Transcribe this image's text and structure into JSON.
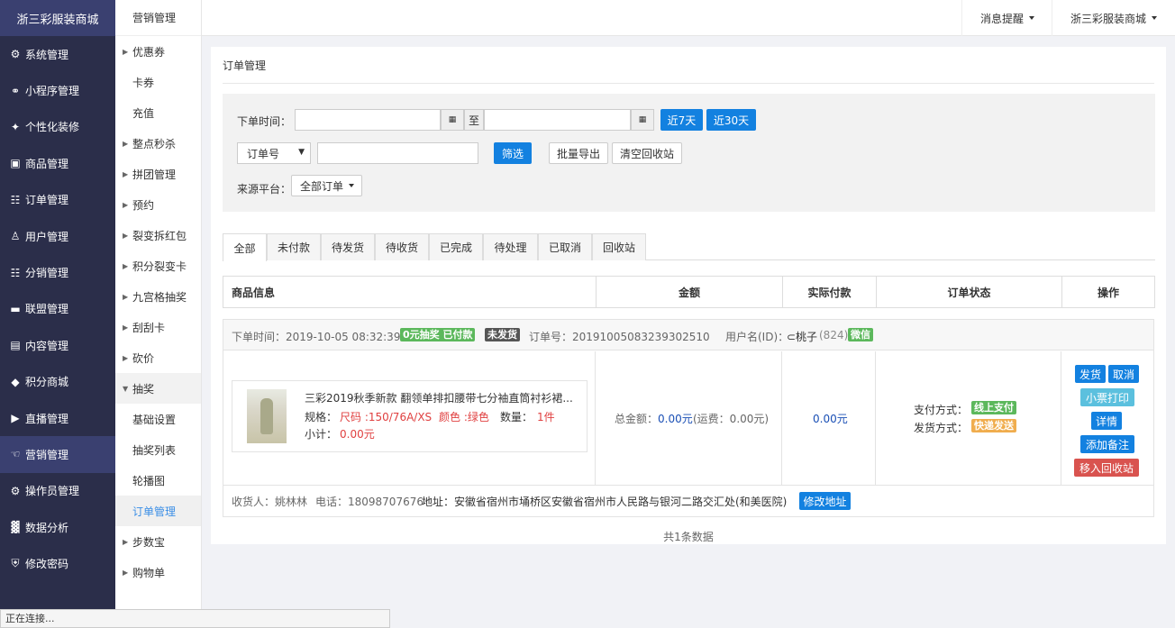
{
  "brand": "浙三彩服装商城",
  "sidebar": {
    "items": [
      {
        "label": "系统管理",
        "icon": "gear-icon"
      },
      {
        "label": "小程序管理",
        "icon": "link-icon"
      },
      {
        "label": "个性化装修",
        "icon": "diamond-icon"
      },
      {
        "label": "商品管理",
        "icon": "bag-icon"
      },
      {
        "label": "订单管理",
        "icon": "clipboard-icon"
      },
      {
        "label": "用户管理",
        "icon": "user-icon"
      },
      {
        "label": "分销管理",
        "icon": "sitemap-icon"
      },
      {
        "label": "联盟管理",
        "icon": "card-icon"
      },
      {
        "label": "内容管理",
        "icon": "newspaper-icon"
      },
      {
        "label": "积分商城",
        "icon": "cube-icon"
      },
      {
        "label": "直播管理",
        "icon": "play-icon"
      },
      {
        "label": "营销管理",
        "icon": "hand-icon"
      },
      {
        "label": "操作员管理",
        "icon": "cog-icon"
      },
      {
        "label": "数据分析",
        "icon": "bar-chart-icon"
      },
      {
        "label": "修改密码",
        "icon": "shield-icon"
      }
    ],
    "active_index": 11
  },
  "subnav": {
    "title": "营销管理",
    "items": [
      {
        "label": "优惠券",
        "arrow": "right"
      },
      {
        "label": "卡券",
        "arrow": "none"
      },
      {
        "label": "充值",
        "arrow": "none"
      },
      {
        "label": "整点秒杀",
        "arrow": "right"
      },
      {
        "label": "拼团管理",
        "arrow": "right"
      },
      {
        "label": "预约",
        "arrow": "right"
      },
      {
        "label": "裂变拆红包",
        "arrow": "right"
      },
      {
        "label": "积分裂变卡",
        "arrow": "right"
      },
      {
        "label": "九宫格抽奖",
        "arrow": "right"
      },
      {
        "label": "刮刮卡",
        "arrow": "right"
      },
      {
        "label": "砍价",
        "arrow": "right"
      },
      {
        "label": "抽奖",
        "arrow": "down"
      },
      {
        "label": "基础设置",
        "arrow": "child"
      },
      {
        "label": "抽奖列表",
        "arrow": "child"
      },
      {
        "label": "轮播图",
        "arrow": "child"
      },
      {
        "label": "订单管理",
        "arrow": "child"
      },
      {
        "label": "步数宝",
        "arrow": "right"
      },
      {
        "label": "购物单",
        "arrow": "right"
      }
    ]
  },
  "topbar": {
    "notifications": "消息提醒",
    "shop": "浙三彩服装商城"
  },
  "page": {
    "title": "订单管理",
    "filters": {
      "order_time_label": "下单时间：",
      "start_date": "",
      "to_label": "至",
      "end_date": "",
      "last7": "近7天",
      "last30": "近30天",
      "field_select": "订单号",
      "keyword": "",
      "filter_btn": "筛选",
      "export_btn": "批量导出",
      "clear_recycle_btn": "清空回收站",
      "source_label": "来源平台：",
      "source_value": "全部订单"
    },
    "tabs": [
      "全部",
      "未付款",
      "待发货",
      "待收货",
      "已完成",
      "待处理",
      "已取消",
      "回收站"
    ],
    "active_tab": 0,
    "table_headers": [
      "商品信息",
      "金额",
      "实际付款",
      "订单状态",
      "操作"
    ],
    "order": {
      "time": "下单时间：2019-10-05 08:32:39",
      "badge_type": "0元抽奖 已付款",
      "badge_ship": "未发货",
      "order_no": "订单号：20191005083239302510",
      "user": "用户名(ID)：",
      "user_name": "⊂桃子",
      "user_id": "(824)",
      "channel": "微信",
      "product_name": "三彩2019秋季新款 翻领单排扣腰带七分袖直筒衬衫裙...",
      "spec_label": "规格：",
      "size": "尺码 :150/76A/XS",
      "color": "颜色 :绿色",
      "qty_label": "数量：",
      "qty": "1件",
      "subtotal_label": "小计：",
      "subtotal": "0.00元",
      "total_label": "总金额：",
      "total": "0.00元",
      "shipping": "(运费：0.00元)",
      "paid": "0.00元",
      "pay_method_label": "支付方式：",
      "pay_method": "线上支付",
      "ship_method_label": "发货方式：",
      "ship_method": "快递发送",
      "actions": {
        "ship": "发货",
        "cancel": "取消",
        "print": "小票打印",
        "detail": "详情",
        "note": "添加备注",
        "recycle": "移入回收站"
      },
      "receiver": "收货人：姚林林",
      "phone": "电话：18098707676",
      "address": "地址：安徽省宿州市埇桥区安徽省宿州市人民路与银河二路交汇处(和美医院)",
      "edit_address": "修改地址"
    },
    "total_count": "共1条数据"
  },
  "status_bar": "正在连接...",
  "colors": {
    "sidebar_bg": "#2b2e4a",
    "brand_bg": "#3a4070",
    "primary": "#1381e0",
    "green": "#5cb85c",
    "dark": "#555555",
    "orange": "#f0ad4e",
    "info": "#5bc0de",
    "danger": "#d9534f"
  }
}
